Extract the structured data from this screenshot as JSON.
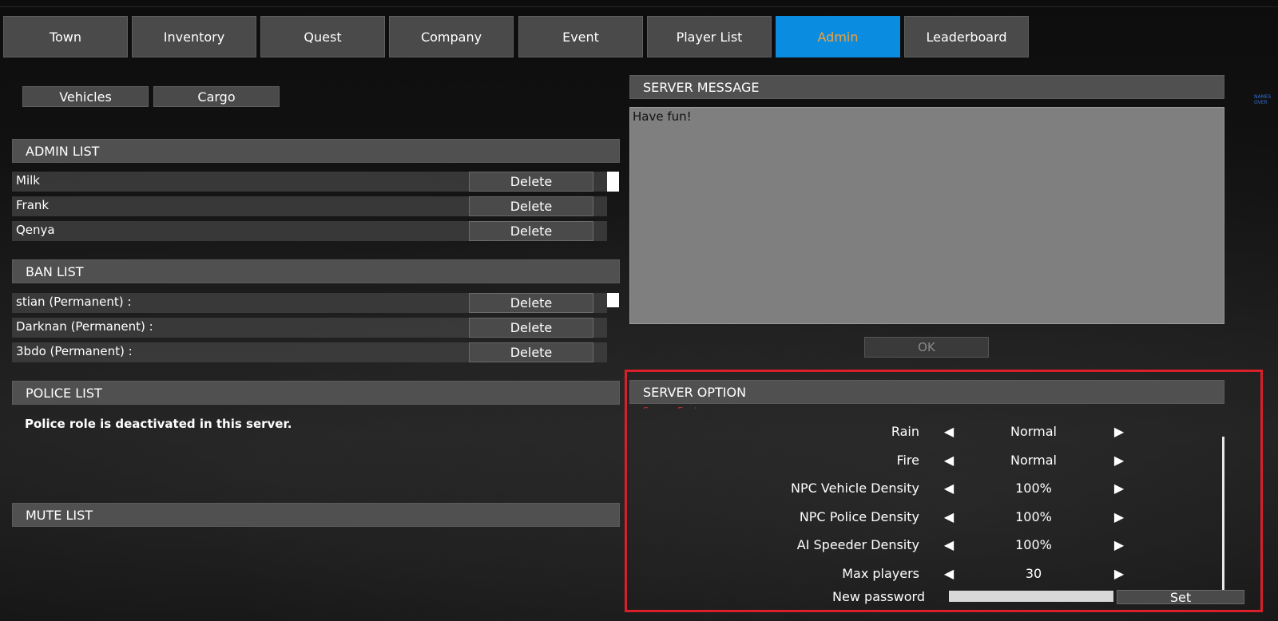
{
  "tabs": [
    {
      "label": "Town",
      "active": false
    },
    {
      "label": "Inventory",
      "active": false
    },
    {
      "label": "Quest",
      "active": false
    },
    {
      "label": "Company",
      "active": false
    },
    {
      "label": "Event",
      "active": false
    },
    {
      "label": "Player List",
      "active": false
    },
    {
      "label": "Admin",
      "active": true
    },
    {
      "label": "Leaderboard",
      "active": false
    }
  ],
  "subtabs": [
    {
      "label": "Vehicles"
    },
    {
      "label": "Cargo"
    }
  ],
  "admin_list": {
    "title": "ADMIN LIST",
    "delete_label": "Delete",
    "entries": [
      "Milk",
      "Frank",
      "Qenya"
    ]
  },
  "ban_list": {
    "title": "BAN LIST",
    "delete_label": "Delete",
    "entries": [
      "stian (Permanent) :",
      "Darknan (Permanent) :",
      "3bdo (Permanent) :"
    ]
  },
  "police_list": {
    "title": "POLICE LIST",
    "notice": "Police role is deactivated in this server."
  },
  "mute_list": {
    "title": "MUTE LIST"
  },
  "server_message": {
    "title": "SERVER MESSAGE",
    "text": "Have fun!",
    "ok_label": "OK"
  },
  "server_option": {
    "title": "SERVER OPTION",
    "clipped_text": "Server Features",
    "options": [
      {
        "label": "Rain",
        "value": "Normal"
      },
      {
        "label": "Fire",
        "value": "Normal"
      },
      {
        "label": "NPC Vehicle Density",
        "value": "100%"
      },
      {
        "label": "NPC Police Density",
        "value": "100%"
      },
      {
        "label": "AI Speeder Density",
        "value": "100%"
      },
      {
        "label": "Max players",
        "value": "30"
      }
    ],
    "password_label": "New password",
    "password_value": "",
    "set_label": "Set",
    "arrow_left": "◀",
    "arrow_right": "▶"
  },
  "side_tag": "NAMES OVER",
  "colors": {
    "active_tab_bg": "#0a8ce0",
    "active_tab_text": "#f0a33a",
    "highlight_frame": "#d91f2a",
    "header_bg": "#505050",
    "button_bg": "#4a4a4a",
    "message_bg": "#7f7f7f"
  },
  "icons": {
    "arrow_left": "triangle-left-icon",
    "arrow_right": "triangle-right-icon"
  }
}
